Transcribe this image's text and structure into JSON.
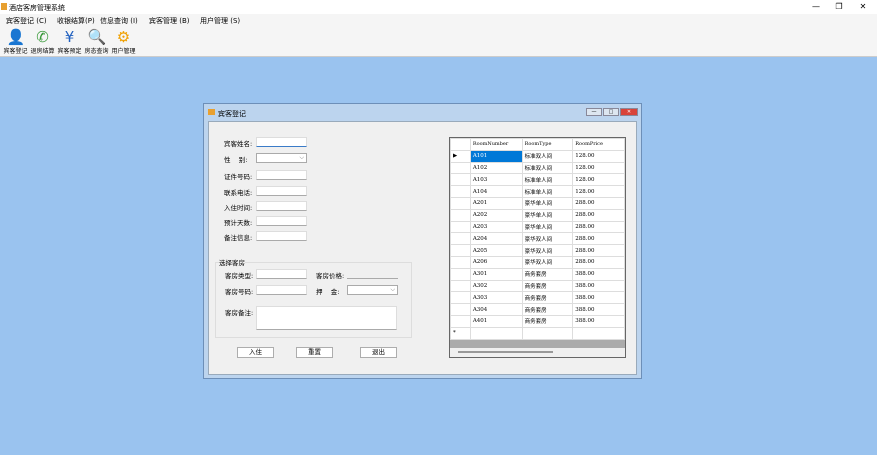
{
  "app": {
    "title": "酒店客房管理系统",
    "minimize": "—",
    "maximize": "❐",
    "close": "✕"
  },
  "menu": [
    "宾客登记 (C)",
    "收银结算(P)",
    "信息查询 (I)",
    "宾客管理 (B)",
    "用户管理 (S)"
  ],
  "toolbar": [
    {
      "label": "宾客登记",
      "icon": "person-icon",
      "glyph": "👤",
      "color": "#3a9a3a"
    },
    {
      "label": "退房结算",
      "icon": "phone-icon",
      "glyph": "✆",
      "color": "#3a9a3a"
    },
    {
      "label": "宾客预定",
      "icon": "yen-icon",
      "glyph": "¥",
      "color": "#1f5fbf"
    },
    {
      "label": "房态查询",
      "icon": "magnifier-icon",
      "glyph": "🔍",
      "color": "#2aa0c0"
    },
    {
      "label": "用户管理",
      "icon": "gear-icon",
      "glyph": "⚙",
      "color": "#f0a000"
    }
  ],
  "dialog": {
    "title": "宾客登记",
    "labels": {
      "name": "宾客姓名:",
      "gender": "性    别:",
      "id": "证件号码:",
      "phone": "联系电话:",
      "checkin": "入住时间:",
      "days": "预计天数:",
      "note": "备注信息:"
    },
    "group": {
      "title": "选择客房",
      "room_type": "客房类型:",
      "room_price": "客房价格:",
      "room_number": "客房号码:",
      "deposit": "押    金:",
      "room_note": "客房备注:"
    },
    "buttons": {
      "checkin": "入住",
      "reset": "重置",
      "exit": "退出"
    }
  },
  "grid": {
    "columns": [
      "RoomNumber",
      "RoomType",
      "RoomPrice"
    ],
    "rows": [
      [
        "A101",
        "标准双人间",
        "128.00"
      ],
      [
        "A102",
        "标准双人间",
        "128.00"
      ],
      [
        "A103",
        "标准单人间",
        "128.00"
      ],
      [
        "A104",
        "标准单人间",
        "128.00"
      ],
      [
        "A201",
        "豪华单人间",
        "288.00"
      ],
      [
        "A202",
        "豪华单人间",
        "288.00"
      ],
      [
        "A203",
        "豪华单人间",
        "288.00"
      ],
      [
        "A204",
        "豪华双人间",
        "288.00"
      ],
      [
        "A205",
        "豪华双人间",
        "288.00"
      ],
      [
        "A206",
        "豪华双人间",
        "288.00"
      ],
      [
        "A301",
        "商务套房",
        "388.00"
      ],
      [
        "A302",
        "商务套房",
        "388.00"
      ],
      [
        "A303",
        "商务套房",
        "388.00"
      ],
      [
        "A304",
        "商务套房",
        "388.00"
      ],
      [
        "A401",
        "商务套房",
        "388.00"
      ]
    ],
    "current_marker": "▶",
    "new_marker": "*"
  }
}
